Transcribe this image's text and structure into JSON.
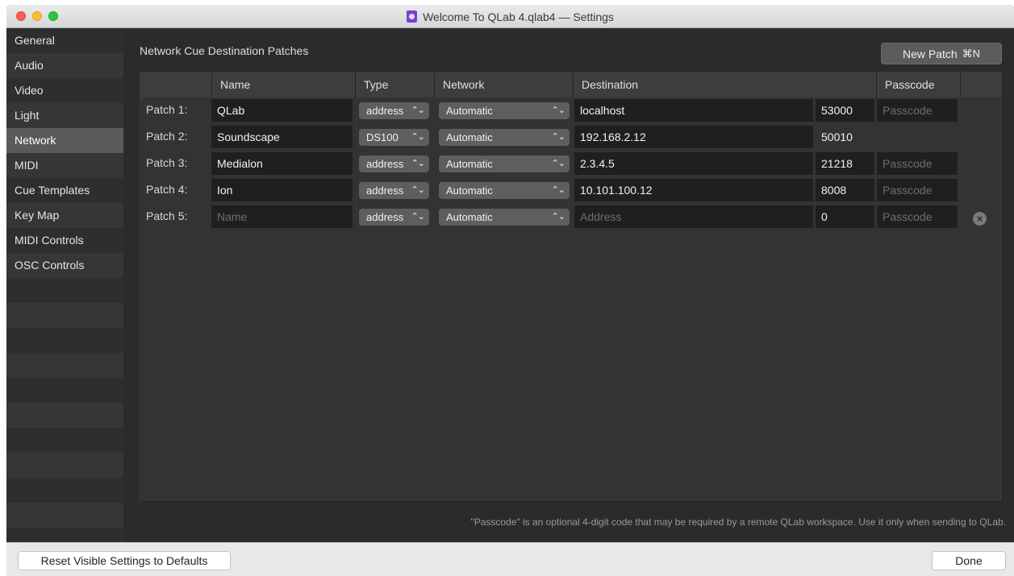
{
  "window": {
    "title": "Welcome To QLab 4.qlab4 — Settings"
  },
  "sidebar": {
    "items": [
      {
        "label": "General"
      },
      {
        "label": "Audio"
      },
      {
        "label": "Video"
      },
      {
        "label": "Light"
      },
      {
        "label": "Network",
        "selected": true
      },
      {
        "label": "MIDI"
      },
      {
        "label": "Cue Templates"
      },
      {
        "label": "Key Map"
      },
      {
        "label": "MIDI Controls"
      },
      {
        "label": "OSC Controls"
      }
    ]
  },
  "main": {
    "section_title": "Network Cue Destination Patches",
    "new_patch_label": "New Patch",
    "new_patch_shortcut": "⌘N",
    "columns": [
      "Name",
      "Type",
      "Network",
      "Destination",
      "Passcode"
    ],
    "patches": [
      {
        "label": "Patch 1:",
        "name": "QLab",
        "type": "address",
        "network": "Automatic",
        "destination": "localhost",
        "port": "53000",
        "passcode": "Passcode"
      },
      {
        "label": "Patch 2:",
        "name": "Soundscape",
        "type": "DS100",
        "network": "Automatic",
        "destination": "192.168.2.12",
        "port": "50010",
        "passcode": ""
      },
      {
        "label": "Patch 3:",
        "name": "Medialon",
        "type": "address",
        "network": "Automatic",
        "destination": "2.3.4.5",
        "port": "21218",
        "passcode": "Passcode"
      },
      {
        "label": "Patch 4:",
        "name": "Ion",
        "type": "address",
        "network": "Automatic",
        "destination": "10.101.100.12",
        "port": "8008",
        "passcode": "Passcode"
      },
      {
        "label": "Patch 5:",
        "name": "Name",
        "type": "address",
        "network": "Automatic",
        "destination": "Address",
        "port": "0",
        "passcode": "Passcode"
      }
    ],
    "footnote": "\"Passcode\" is an optional 4-digit code that may be required by a remote QLab workspace. Use it only when sending to QLab."
  },
  "bottom": {
    "reset_label": "Reset Visible Settings to Defaults",
    "done_label": "Done"
  },
  "icons": {
    "popup_arrows": "⌃⌄",
    "remove": "×"
  },
  "colors": {
    "selected_sidebar": "#5a5a5a",
    "panel": "#2b2b2b"
  }
}
